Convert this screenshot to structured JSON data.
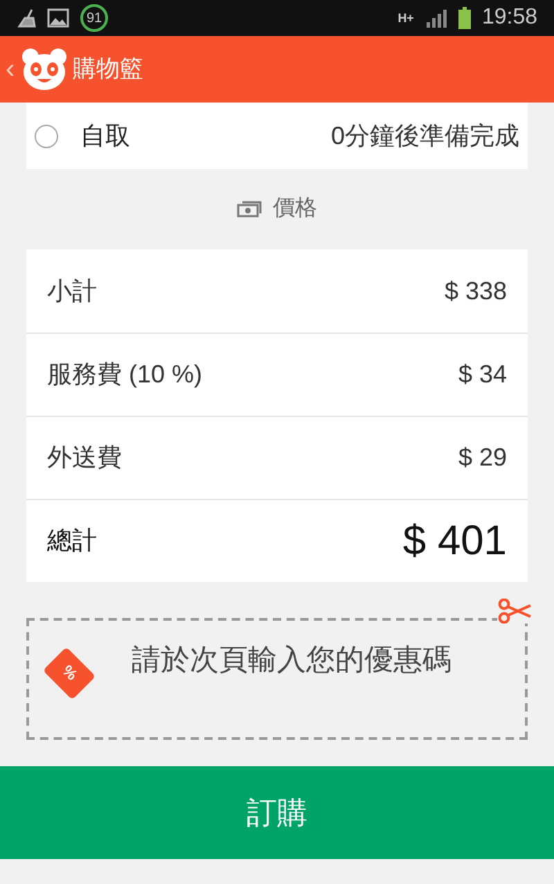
{
  "status_bar": {
    "badge": "91",
    "network": "H+",
    "time": "19:58"
  },
  "header": {
    "back": "‹",
    "title": "購物籃"
  },
  "pickup_option": {
    "label": "自取",
    "note": "0分鐘後準備完成",
    "selected": false
  },
  "price_section": {
    "title": "價格",
    "rows": [
      {
        "label": "小計",
        "value": "$ 338",
        "kind": "line"
      },
      {
        "label": "服務費 (10 %)",
        "value": "$ 34",
        "kind": "line"
      },
      {
        "label": "外送費",
        "value": "$ 29",
        "kind": "line"
      },
      {
        "label": "總計",
        "value": "$ 401",
        "kind": "total"
      }
    ]
  },
  "coupon": {
    "tag": "%",
    "text": "請於次頁輸入您的優惠碼"
  },
  "order_button": "訂購"
}
